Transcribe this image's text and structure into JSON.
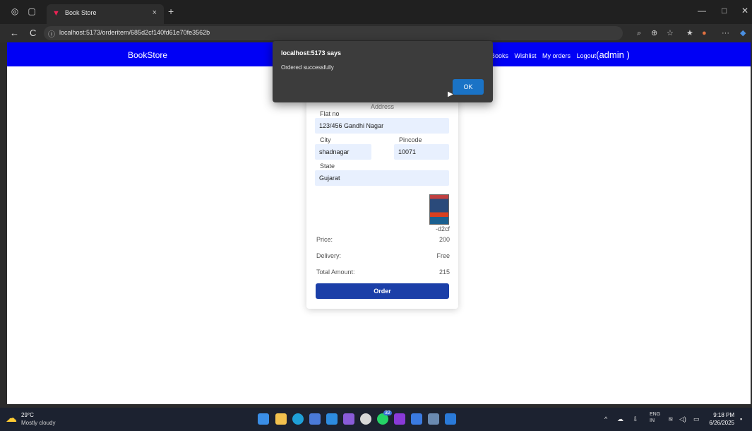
{
  "browser": {
    "tab_title": "Book Store",
    "tab_close": "×",
    "new_tab": "+",
    "url": "localhost:5173/orderitem/685d2cf140fd61e70fe3562b",
    "back": "←",
    "refresh": "C",
    "minimize": "—",
    "maximize": "□",
    "close": "✕",
    "more": "···"
  },
  "navbar": {
    "brand": "BookStore",
    "links": [
      "Books",
      "Wishlist",
      "My orders",
      "Logout"
    ],
    "admin": "(admin )",
    "color": "#0000f5"
  },
  "address_form": {
    "title": "Address",
    "flat_label": "Flat no",
    "flat_value": "123/456 Gandhi Nagar",
    "city_label": "City",
    "city_value": "shadnagar",
    "pincode_label": "Pincode",
    "pincode_value": "10071",
    "state_label": "State",
    "state_value": "Gujarat"
  },
  "order": {
    "book_id": "-d2cf",
    "price_label": "Price:",
    "price_value": "200",
    "delivery_label": "Delivery:",
    "delivery_value": "Free",
    "total_label": "Total Amount:",
    "total_value": "215",
    "order_button": "Order",
    "button_color": "#1b3fa8"
  },
  "dialog": {
    "title": "localhost:5173 says",
    "message": "Ordered successfully",
    "ok_label": "OK"
  },
  "taskbar": {
    "weather_temp": "29°C",
    "weather_desc": "Mostly cloudy",
    "lang_top": "ENG",
    "lang_bottom": "IN",
    "time": "9:18 PM",
    "date": "6/26/2025",
    "badge": "32"
  }
}
